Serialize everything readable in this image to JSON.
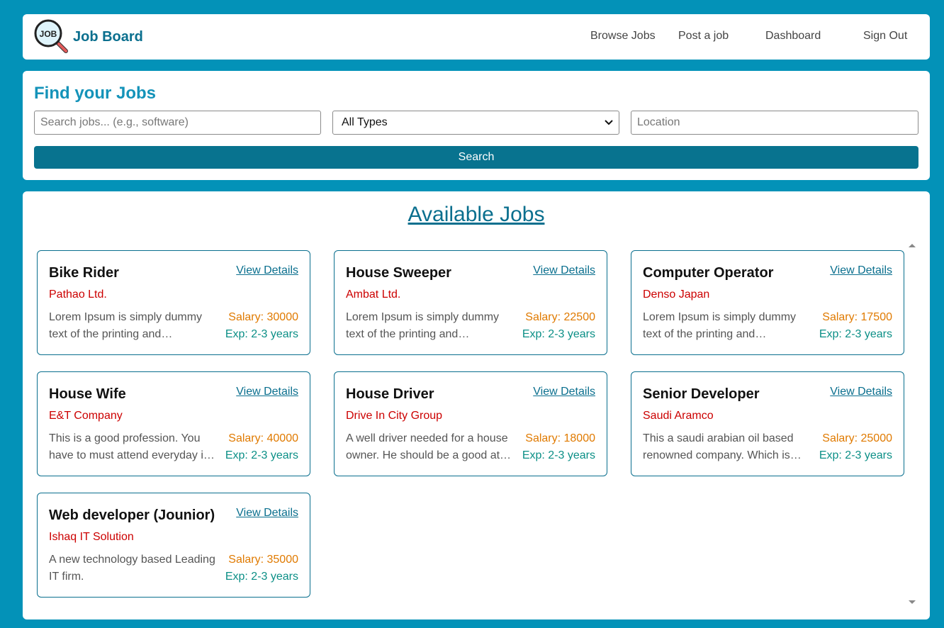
{
  "navbar": {
    "brand": "Job Board",
    "logo_text": "JOB",
    "links": [
      "Browse Jobs",
      "Post a job",
      "Dashboard",
      "Sign Out"
    ]
  },
  "search": {
    "title": "Find your Jobs",
    "keyword_placeholder": "Search jobs... (e.g., software)",
    "type_selected": "All Types",
    "location_placeholder": "Location",
    "button_label": "Search"
  },
  "jobs": {
    "title": "Available Jobs",
    "view_label": "View Details",
    "items": [
      {
        "title": "Bike Rider",
        "company": "Pathao Ltd.",
        "desc": "Lorem Ipsum is simply dummy text of the printing and…",
        "salary": "Salary: 30000",
        "exp": "Exp: 2-3 years"
      },
      {
        "title": "House Sweeper",
        "company": "Ambat Ltd.",
        "desc": "Lorem Ipsum is simply dummy text of the printing and…",
        "salary": "Salary: 22500",
        "exp": "Exp: 2-3 years"
      },
      {
        "title": "Computer Operator",
        "company": "Denso Japan",
        "desc": "Lorem Ipsum is simply dummy text of the printing and…",
        "salary": "Salary: 17500",
        "exp": "Exp: 2-3 years"
      },
      {
        "title": "House Wife",
        "company": "E&T Company",
        "desc": "This is a good profession. You have to must attend everyday i…",
        "salary": "Salary: 40000",
        "exp": "Exp: 2-3 years"
      },
      {
        "title": "House Driver",
        "company": "Drive In City Group",
        "desc": "A well driver needed for a house owner. He should be a good at…",
        "salary": "Salary: 18000",
        "exp": "Exp: 2-3 years"
      },
      {
        "title": "Senior Developer",
        "company": "Saudi Aramco",
        "desc": "This a saudi arabian oil based renowned company. Which is…",
        "salary": "Salary: 25000",
        "exp": "Exp: 2-3 years"
      },
      {
        "title": "Web developer (Jounior)",
        "company": "Ishaq IT Solution",
        "desc": "A new technology based Leading IT firm.",
        "salary": "Salary: 35000",
        "exp": "Exp: 2-3 years"
      }
    ]
  }
}
